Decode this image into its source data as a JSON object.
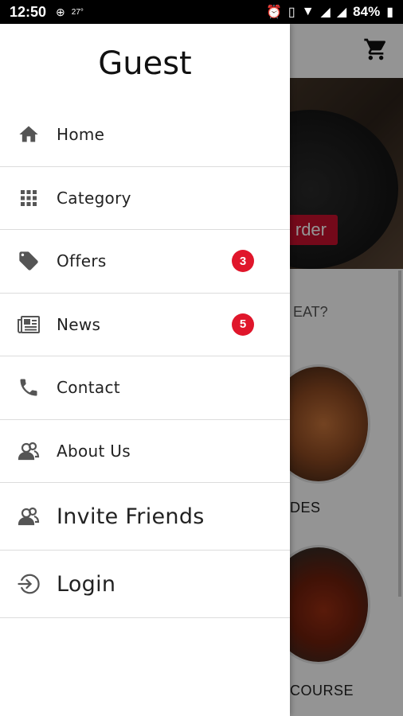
{
  "status_bar": {
    "time": "12:50",
    "temp": "27°",
    "battery": "84%"
  },
  "background": {
    "order_button": "rder",
    "section_question": "EAT?",
    "category_1": "DES",
    "category_2": "COURSE"
  },
  "drawer": {
    "title": "Guest",
    "items": [
      {
        "label": "Home",
        "icon": "home-icon"
      },
      {
        "label": "Category",
        "icon": "grid-icon"
      },
      {
        "label": "Offers",
        "icon": "tag-icon",
        "badge": "3"
      },
      {
        "label": "News",
        "icon": "newspaper-icon",
        "badge": "5"
      },
      {
        "label": "Contact",
        "icon": "phone-icon"
      },
      {
        "label": "About Us",
        "icon": "people-icon"
      },
      {
        "label": "Invite Friends",
        "icon": "people-icon"
      },
      {
        "label": "Login",
        "icon": "login-icon"
      }
    ]
  },
  "colors": {
    "accent": "#c8102e",
    "badge": "#e0162b"
  }
}
